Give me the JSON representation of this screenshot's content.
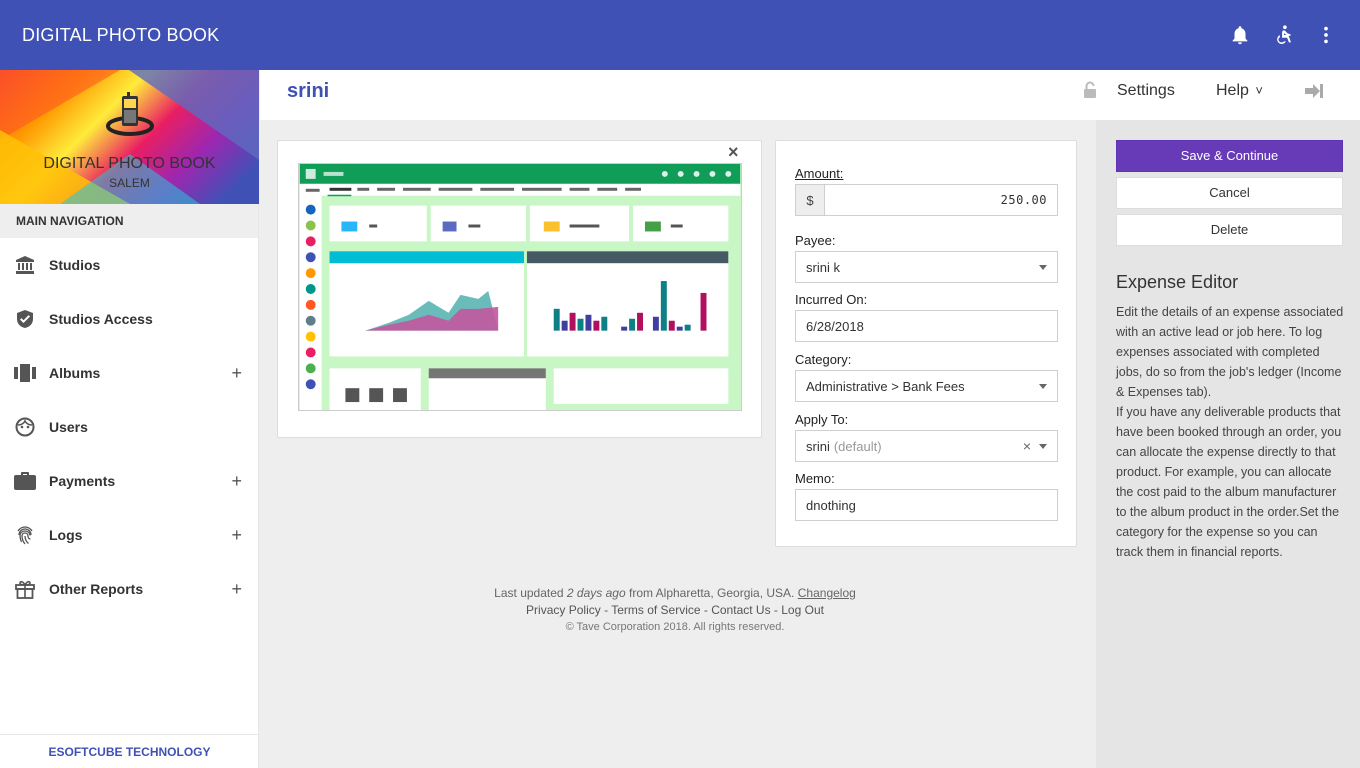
{
  "app": {
    "title": "DIGITAL PHOTO BOOK"
  },
  "top_icons": [
    "bell-icon",
    "accessibility-icon",
    "more-vert-icon"
  ],
  "sidebar": {
    "brand_title": "DIGITAL PHOTO BOOK",
    "brand_subtitle": "SALEM",
    "nav_heading": "MAIN NAVIGATION",
    "items": [
      {
        "label": "Studios",
        "icon": "bank-icon",
        "expandable": false
      },
      {
        "label": "Studios Access",
        "icon": "shield-icon",
        "expandable": false
      },
      {
        "label": "Albums",
        "icon": "album-icon",
        "expandable": true
      },
      {
        "label": "Users",
        "icon": "face-icon",
        "expandable": false
      },
      {
        "label": "Payments",
        "icon": "briefcase-icon",
        "expandable": true
      },
      {
        "label": "Logs",
        "icon": "fingerprint-icon",
        "expandable": true
      },
      {
        "label": "Other Reports",
        "icon": "gift-icon",
        "expandable": true
      }
    ],
    "plus": "+",
    "footer": "ESOFTCUBE TECHNOLOGY"
  },
  "header": {
    "title": "srini",
    "settings": "Settings",
    "help": "Help",
    "help_caret": "˅"
  },
  "preview": {
    "close": "×"
  },
  "form": {
    "amount_label": "Amount:",
    "currency": "$",
    "amount_value": "250.00",
    "payee_label": "Payee:",
    "payee_value": "srini k",
    "incurred_label": "Incurred On:",
    "incurred_value": "6/28/2018",
    "category_label": "Category:",
    "category_value": "Administrative > Bank Fees",
    "apply_label": "Apply To:",
    "apply_value": "srini",
    "apply_hint": "(default)",
    "clear": "×",
    "memo_label": "Memo:",
    "memo_value": "dnothing"
  },
  "footer": {
    "updated_prefix": "Last updated",
    "updated_time": "2 days ago",
    "updated_suffix": "from Alpharetta, Georgia, USA.",
    "changelog": "Changelog",
    "privacy": "Privacy Policy",
    "terms": "Terms of Service",
    "contact": "Contact Us",
    "logout": "Log Out",
    "sep": " - ",
    "copyright": "© Tave Corporation 2018. All rights reserved."
  },
  "actions": {
    "save": "Save & Continue",
    "cancel": "Cancel",
    "delete": "Delete"
  },
  "help_panel": {
    "title": "Expense Editor",
    "p1": "Edit the details of an expense associated with an active lead or job here. To log expenses associated with completed jobs, do so from the job's ledger (Income & Expenses tab).",
    "p2": "If you have any deliverable products that have been booked through an order, you can allocate the expense directly to that product. For example, you can allocate the cost paid to the album manufacturer to the album product in the order.Set the category for the expense so you can track them in financial reports."
  },
  "colors": {
    "primary": "#3f51b5",
    "accent": "#673ab7",
    "panel": "#e5e5e5"
  }
}
